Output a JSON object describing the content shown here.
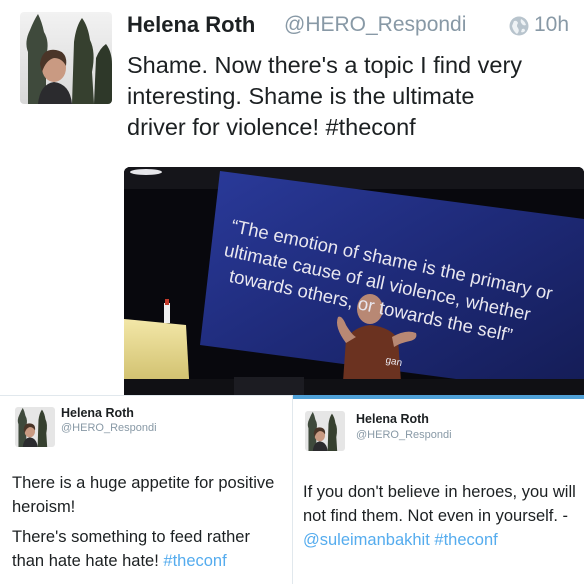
{
  "main_tweet": {
    "name": "Helena Roth",
    "handle": "@HERO_Respondi",
    "time": "10h",
    "text_lines": [
      "Shame. Now there's a topic I find very",
      "interesting. Shame is the ultimate",
      "driver for violence! "
    ],
    "hashtag": "#theconf",
    "icons": {
      "globe": "globe-icon"
    }
  },
  "photo": {
    "quote_lines": [
      "“The emotion of shame is the primary or",
      "ultimate cause of all violence, whether",
      "towards others, or towards the self”"
    ],
    "attribution": "gan"
  },
  "card_left": {
    "name": "Helena Roth",
    "handle": "@HERO_Respondi",
    "para1": "There is a huge appetite for positive heroism!",
    "para2_prefix": "There's something to feed rather than hate hate hate! ",
    "hashtag": "#theconf"
  },
  "card_right": {
    "name": "Helena Roth",
    "handle": "@HERO_Respondi",
    "text_prefix": "If you don't believe in heroes, you will not find them. Not even in yourself. - ",
    "mention": "@suleimanbakhit",
    "hashtag": "#theconf"
  },
  "colors": {
    "link": "#55acee",
    "accent_bar": "#4fa1d8",
    "meta_gray": "#8899a6",
    "text": "#1c2022",
    "slide_background": "#1e2a78"
  }
}
